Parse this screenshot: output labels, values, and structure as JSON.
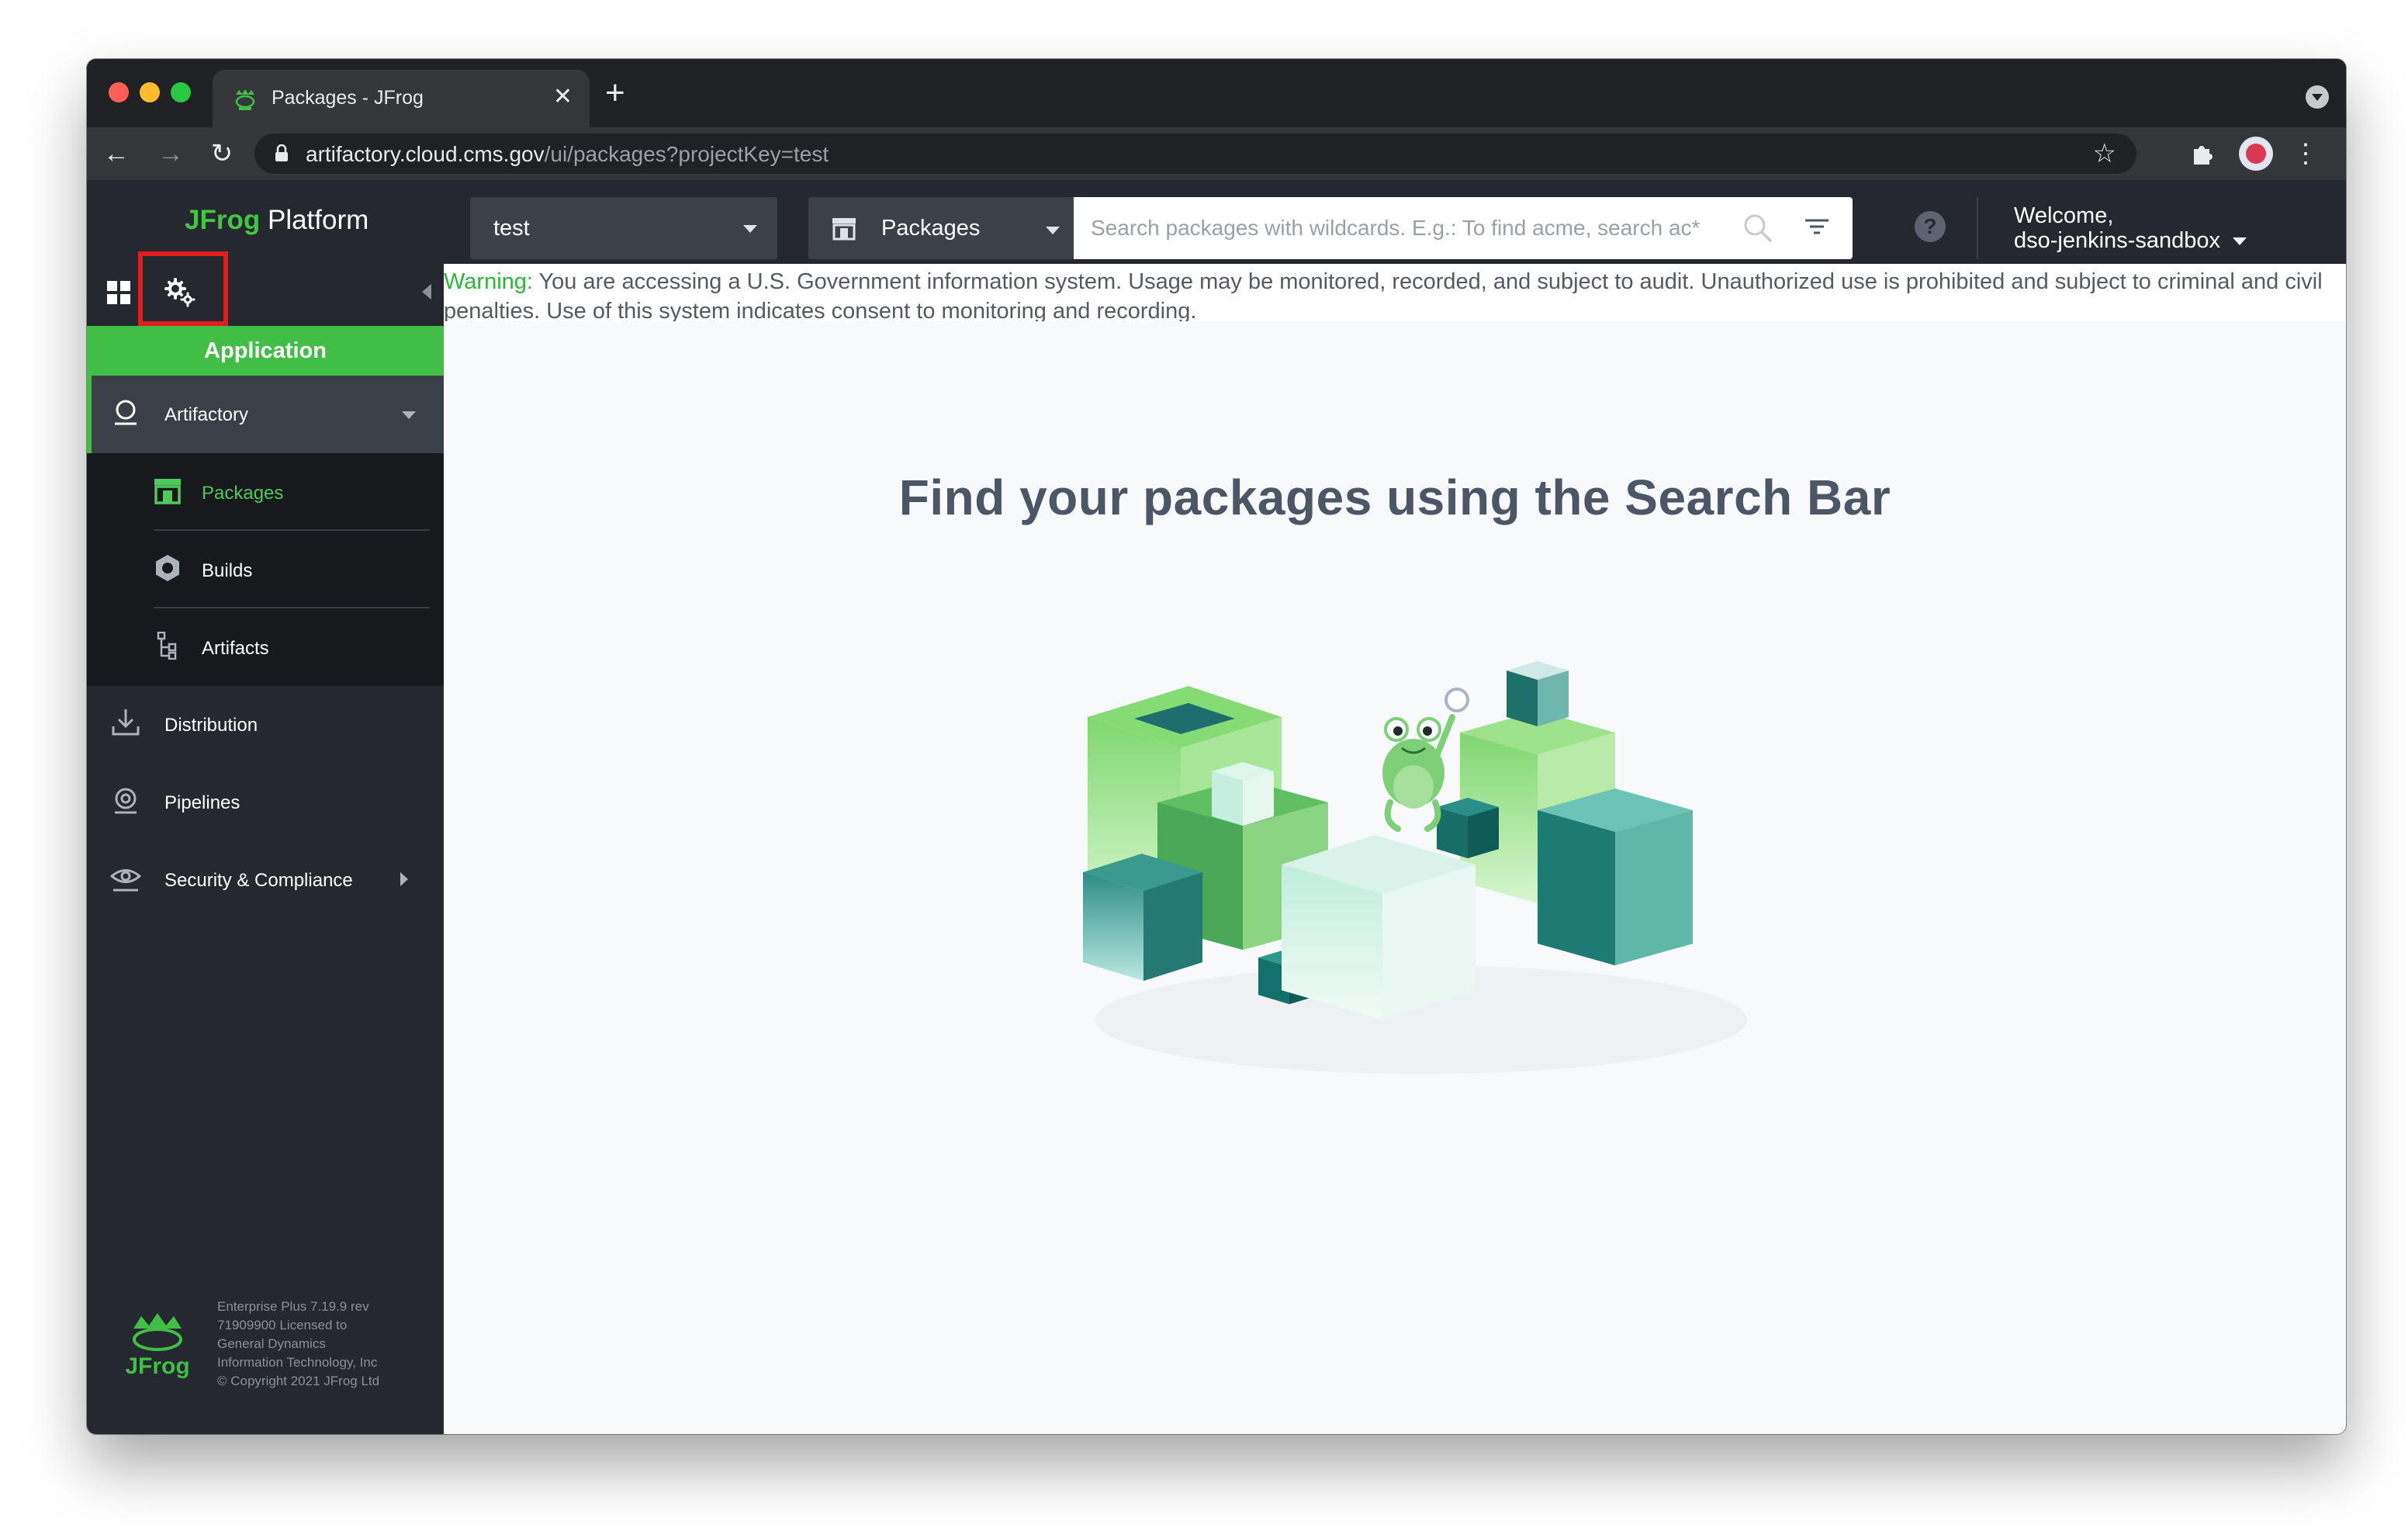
{
  "browser": {
    "tab_title": "Packages - JFrog",
    "url_host": "artifactory.cloud.cms.gov",
    "url_path": "/ui/packages?projectKey=test"
  },
  "sidebar": {
    "brand_jfrog": "JFrog",
    "brand_platform": "Platform",
    "switcher_tab": "Application",
    "items": [
      {
        "label": "Artifactory",
        "icon": "artifactory-icon",
        "expanded": true
      },
      {
        "label": "Distribution",
        "icon": "distribution-icon"
      },
      {
        "label": "Pipelines",
        "icon": "pipelines-icon"
      },
      {
        "label": "Security & Compliance",
        "icon": "shield-eye-icon"
      }
    ],
    "subitems": [
      {
        "label": "Packages",
        "icon": "packages-icon",
        "active": true
      },
      {
        "label": "Builds",
        "icon": "builds-icon"
      },
      {
        "label": "Artifacts",
        "icon": "artifacts-icon"
      }
    ],
    "footer_lines": [
      "Enterprise Plus 7.19.9 rev",
      "71909900 Licensed to",
      "General Dynamics",
      "Information Technology, Inc",
      "© Copyright 2021 JFrog Ltd"
    ]
  },
  "topbar": {
    "project": "test",
    "search_type": "Packages",
    "search_placeholder": "Search packages with wildcards. E.g.: To find acme, search ac*",
    "help": "?",
    "welcome": "Welcome,",
    "username": "dso-jenkins-sandbox"
  },
  "warning": {
    "label": "Warning:",
    "text": " You are accessing a U.S. Government information system. Usage may be monitored, recorded, and subject to audit. Unauthorized use is prohibited and subject to criminal and civil penalties. Use of this system indicates consent to monitoring and recording."
  },
  "main": {
    "headline": "Find your packages using the Search Bar"
  },
  "colors": {
    "accent": "#40be46",
    "sidebar": "#25282e",
    "highlight": "#e21d1d"
  }
}
